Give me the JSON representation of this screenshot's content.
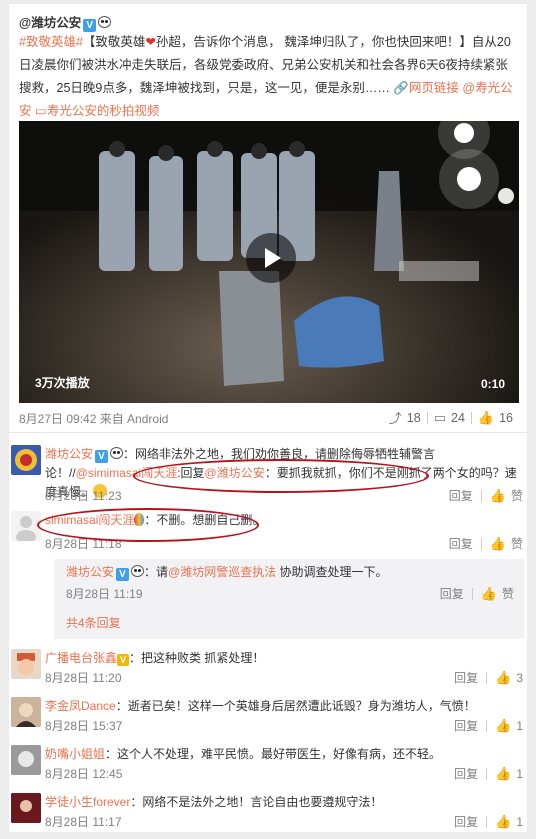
{
  "post": {
    "author": "@潍坊公安",
    "verified_badge": "V",
    "text_parts": {
      "topic": "#致敬英雄#",
      "lead": "【致敬英雄",
      "title_rest": "孙超，告诉你个消息， 魏泽坤归队了，你也快回来吧！】自从20日凌晨你们被洪水冲走失联后，各级党委政府、兄弟公安机关和社会各界6天6夜持续紧张搜救，25日晚9点多，魏泽坤被找到，只是，这一见，便是永别……",
      "web_link": "网页链接",
      "mention": "@寿光公安",
      "video_link": "寿光公安的秒拍视频"
    },
    "video": {
      "plays": "3万次播放",
      "duration": "0:10"
    },
    "meta": "8月27日 09:42 来自 Android",
    "actions": {
      "forward_count": "18",
      "comment_count": "24",
      "like_count": "16"
    }
  },
  "comments": [
    {
      "name": "潍坊公安",
      "text_a": "：网络非法外之地，我们劝你善良，请删除侮辱牺牲辅警言论！//",
      "mention": "@simimasai闯天涯",
      "text_b_prefix": ":回复",
      "mention2": "@潍坊公安",
      "text_b": "：要抓我就抓，你们不是刚抓了两个女的吗？速度真慢。",
      "time": "8月28日 11:23",
      "reply": "回复",
      "like": "赞"
    },
    {
      "name": "simimasai闯天涯",
      "text": "：不删。想删自己删。",
      "time": "8月28日 11:18",
      "reply": "回复",
      "like": "赞"
    },
    {
      "name": "潍坊公安",
      "text_prefix": "：请",
      "mention": "@潍坊网警巡查执法",
      "text": " 协助调查处理一下。",
      "time": "8月28日 11:19",
      "reply": "回复",
      "like": "赞",
      "more": "共4条回复"
    },
    {
      "name": "广播电台张鑫",
      "text": "：把这种败类 抓紧处理！",
      "time": "8月28日 11:20",
      "reply": "回复",
      "like": "3"
    },
    {
      "name": "李金凤Dance",
      "text": "：逝者已矣！这样一个英雄身后居然遭此诋毁？身为潍坊人，气愤！",
      "time": "8月28日 15:37",
      "reply": "回复",
      "like": "1"
    },
    {
      "name": "奶嘴小姐姐",
      "text": "：这个人不处理，难平民愤。最好带医生，好像有病，还不轻。",
      "time": "8月28日 12:45",
      "reply": "回复",
      "like": "1"
    },
    {
      "name": "学徒小生forever",
      "text": "：网络不是法外之地！言论自由也要遵规守法！",
      "time": "8月28日 11:17",
      "reply": "回复",
      "like": "1"
    }
  ],
  "colors": {
    "accent": "#eb7350",
    "annotation": "#b5121b",
    "verified": "#3ea0e8"
  },
  "icons": [
    "verified-icon",
    "panda-icon",
    "link-icon",
    "video-icon",
    "forward-icon",
    "comment-icon",
    "like-icon",
    "play-icon"
  ]
}
